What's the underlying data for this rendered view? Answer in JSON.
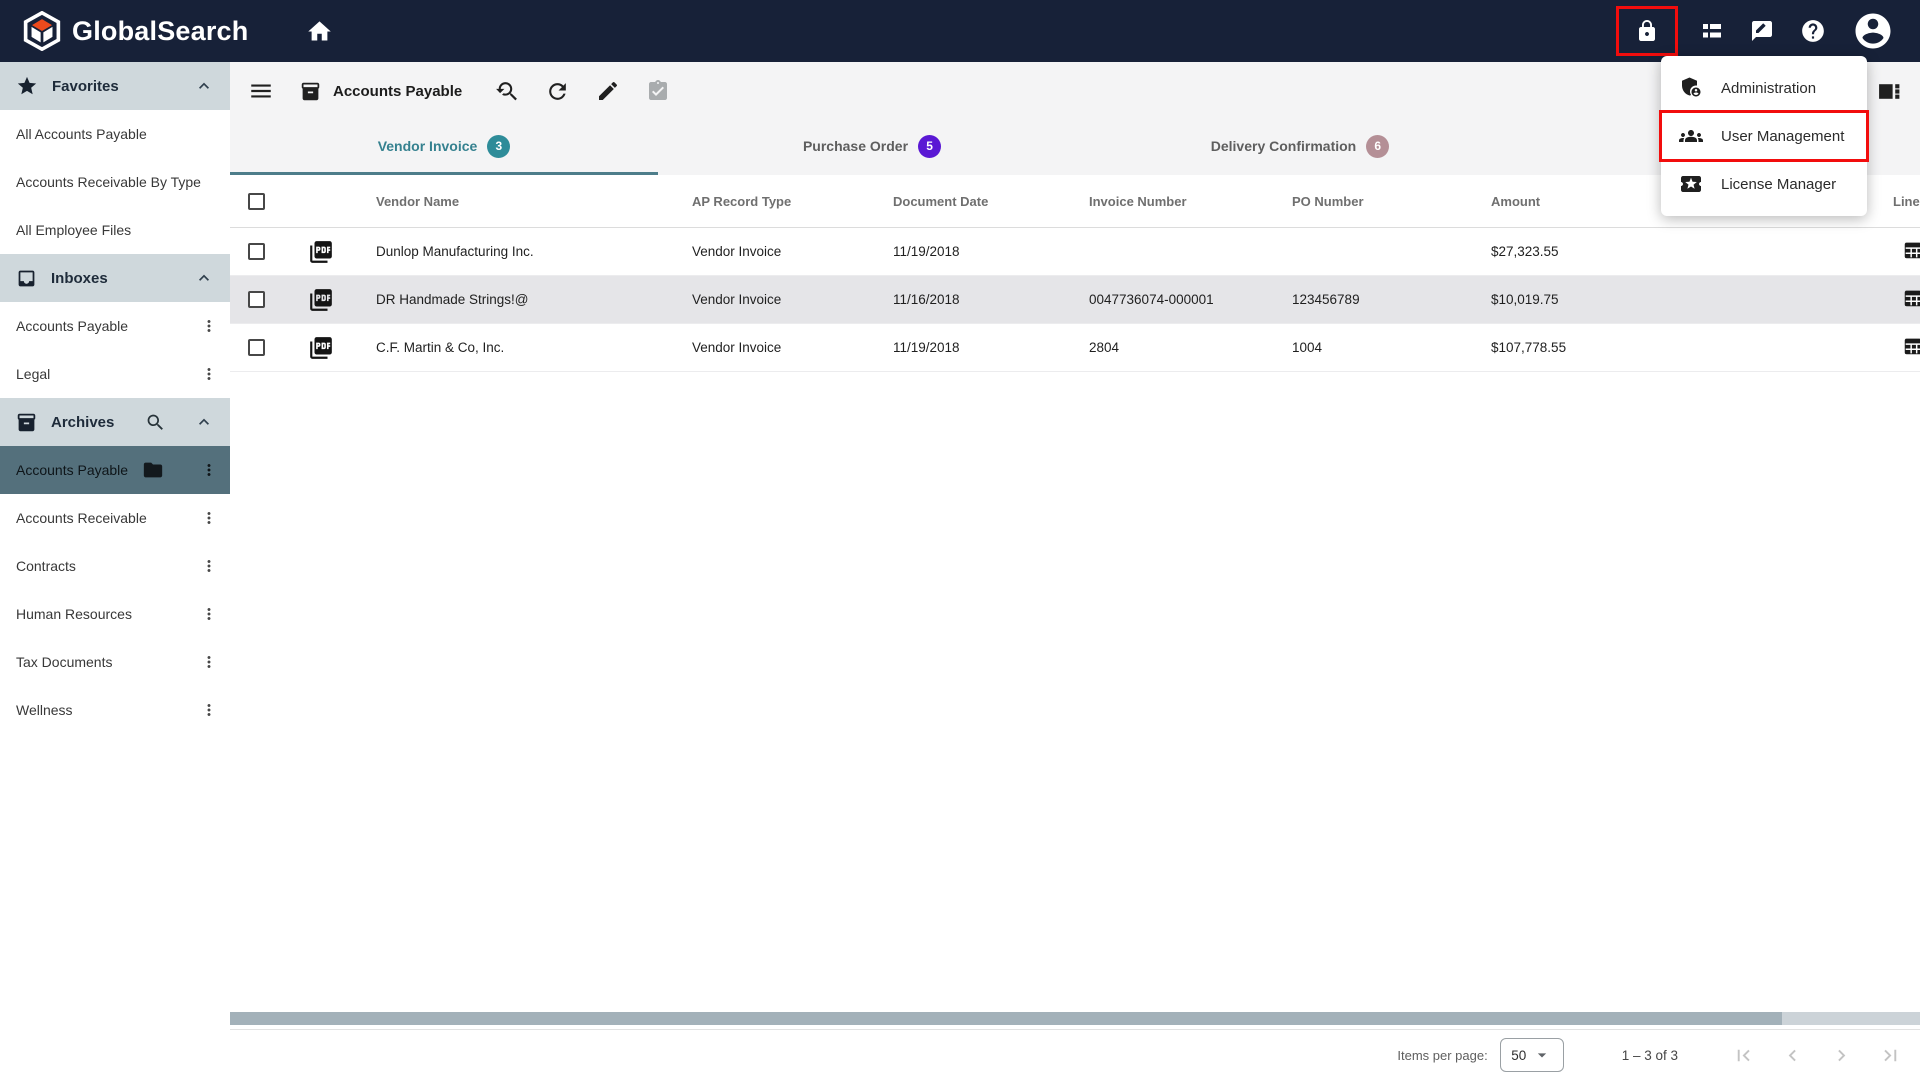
{
  "navbar": {
    "brand": "GlobalSearch"
  },
  "user_menu": {
    "items": [
      {
        "label": "Administration",
        "icon": "admin-shield-icon"
      },
      {
        "label": "User Management",
        "icon": "groups-icon",
        "highlighted": true
      },
      {
        "label": "License Manager",
        "icon": "ticket-star-icon"
      }
    ]
  },
  "sidebar": {
    "favorites": {
      "title": "Favorites",
      "items": [
        "All Accounts Payable",
        "Accounts Receivable By Type",
        "All Employee Files"
      ]
    },
    "inboxes": {
      "title": "Inboxes",
      "items": [
        "Accounts Payable",
        "Legal"
      ]
    },
    "archives": {
      "title": "Archives",
      "items": [
        "Accounts Payable",
        "Accounts Receivable",
        "Contracts",
        "Human Resources",
        "Tax Documents",
        "Wellness"
      ],
      "selected_item": "Accounts Payable"
    }
  },
  "toolbar": {
    "title": "Accounts Payable"
  },
  "tabs": [
    {
      "label": "Vendor Invoice",
      "count": "3",
      "active": true,
      "badge_color": "#2E8C99"
    },
    {
      "label": "Purchase Order",
      "count": "5",
      "active": false,
      "badge_color": "#5A18D4"
    },
    {
      "label": "Delivery Confirmation",
      "count": "6",
      "active": false,
      "badge_color": "#B48F96"
    }
  ],
  "table": {
    "columns": [
      "Vendor Name",
      "AP Record Type",
      "Document Date",
      "Invoice Number",
      "PO Number",
      "Amount",
      "Line Items"
    ],
    "rows": [
      {
        "vendor_name": "Dunlop Manufacturing Inc.",
        "ap_record_type": "Vendor Invoice",
        "document_date": "11/19/2018",
        "invoice_number": "",
        "po_number": "",
        "amount": "$27,323.55"
      },
      {
        "vendor_name": "DR Handmade Strings!@",
        "ap_record_type": "Vendor Invoice",
        "document_date": "11/16/2018",
        "invoice_number": "0047736074-000001",
        "po_number": "123456789",
        "amount": "$10,019.75",
        "highlighted": true
      },
      {
        "vendor_name": "C.F. Martin & Co, Inc.",
        "ap_record_type": "Vendor Invoice",
        "document_date": "11/19/2018",
        "invoice_number": "2804",
        "po_number": "1004",
        "amount": "$107,778.55"
      }
    ]
  },
  "pagination": {
    "items_per_page_label": "Items per page:",
    "page_size": "50",
    "range": "1 – 3 of 3"
  },
  "colors": {
    "navbar_bg": "#172138",
    "accent_teal": "#2E8C99",
    "badge_purple": "#5A18D4",
    "badge_rose": "#B48F96",
    "selected_item_bg": "#54707C",
    "section_header_bg": "#CFD8DC",
    "row_highlight_bg": "#E5E5E8",
    "highlight_red": "#F20D0D"
  }
}
